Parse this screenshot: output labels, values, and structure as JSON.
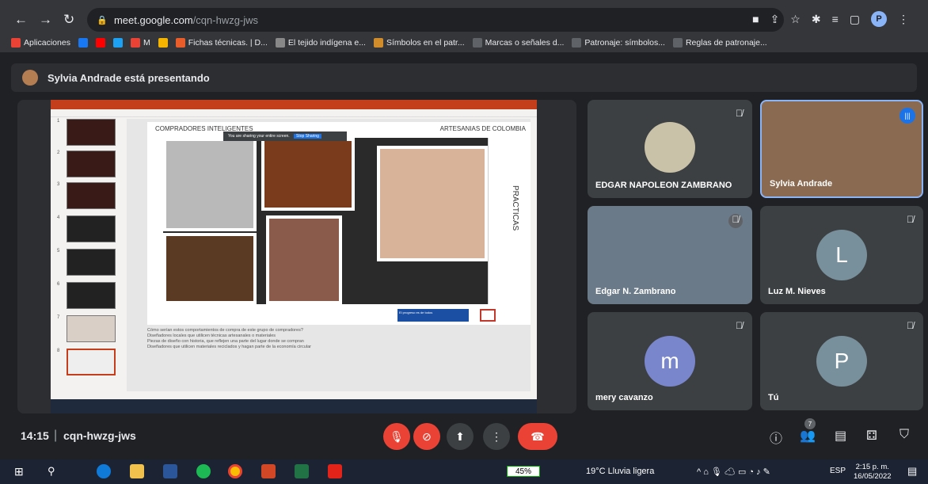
{
  "browser": {
    "url_host": "meet.google.com",
    "url_path": "/cqn-hwzg-jws",
    "profile_initial": "P",
    "bookmarks": [
      {
        "label": "Aplicaciones",
        "color": "#ea4335"
      },
      {
        "label": "",
        "color": "#1877f2"
      },
      {
        "label": "",
        "color": "#ff0000"
      },
      {
        "label": "",
        "color": "#1da1f2"
      },
      {
        "label": "M",
        "color": "#ea4335"
      },
      {
        "label": "",
        "color": "#f4b400"
      },
      {
        "label": "Fichas técnicas. | D...",
        "color": "#e85d2a"
      },
      {
        "label": "El tejido indígena e...",
        "color": "#888888"
      },
      {
        "label": "Símbolos en el patr...",
        "color": "#d08b2a"
      },
      {
        "label": "Marcas o señales d...",
        "color": "#5f6368"
      },
      {
        "label": "Patronaje: símbolos...",
        "color": "#5f6368"
      },
      {
        "label": "Reglas de patronaje...",
        "color": "#5f6368"
      }
    ]
  },
  "meet": {
    "presenting_text": "Sylvia Andrade está presentando",
    "time": "14:15",
    "code": "cqn-hwzg-jws",
    "participants_count": "7",
    "participants": [
      {
        "name": "EDGAR NAPOLEON ZAMBRANO"
      },
      {
        "name": "Sylvia Andrade"
      },
      {
        "name": "Edgar N. Zambrano"
      },
      {
        "name": "Luz M. Nieves",
        "initial": "L"
      },
      {
        "name": "mery cavanzo",
        "initial": "m"
      },
      {
        "name": "Tú",
        "initial": "P"
      }
    ]
  },
  "slide": {
    "header_left": "COMPRADORES INTELIGENTES",
    "header_right": "ARTESANIAS DE COLOMBIA",
    "side_title": "PRACTICAS",
    "share_notice": "You are sharing your entire screen.",
    "stop_sharing": "Stop Sharing",
    "gov_logo": "El progreso es de todos",
    "notes": [
      "Cómo serían estos comportamientos de compra de este grupo de compradores?",
      "Diseñadores locales que utilicen técnicas artesanales o materiales",
      "Piezas de diseño con historia, que reflejen una parte del lugar donde se compran",
      "Diseñadores que utilicen materiales reciclados y hagan parte de la economía circular"
    ]
  },
  "taskbar": {
    "battery": "45%",
    "weather": "19°C  Lluvia ligera",
    "language": "ESP",
    "time": "2:15 p. m.",
    "date": "16/05/2022"
  }
}
